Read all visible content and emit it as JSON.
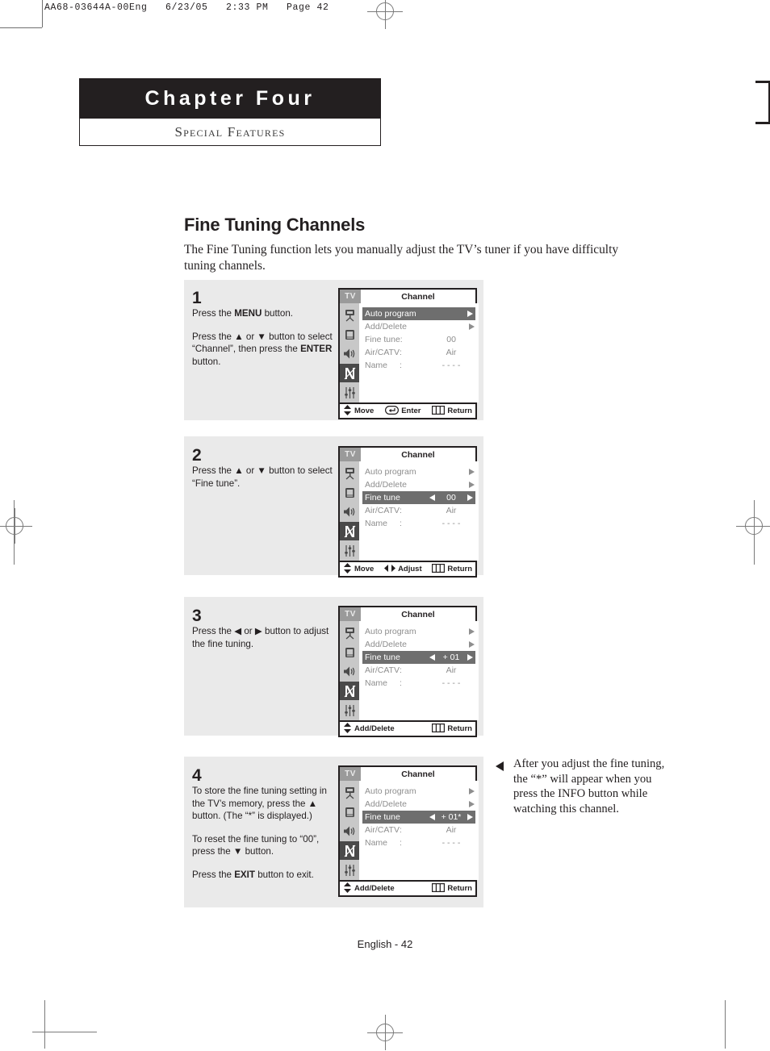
{
  "print_header": "AA68-03644A-00Eng   6/23/05   2:33 PM   Page 42",
  "chapter": {
    "title": "Chapter Four",
    "subtitle": "Special Features"
  },
  "page": {
    "heading": "Fine Tuning Channels",
    "intro": "The Fine Tuning function lets you manually adjust the TV’s tuner if you have difficulty tuning channels.",
    "footer": "English - 42"
  },
  "note": {
    "text": "After you adjust the fine tuning, the “*” will appear when you press the INFO button while watching this channel."
  },
  "osd_common": {
    "tv_label": "TV",
    "title": "Channel",
    "rail_icons": [
      "antenna-icon",
      "picture-icon",
      "sound-icon",
      "channel-icon",
      "setup-icon"
    ],
    "selected_rail_index": 3
  },
  "steps": [
    {
      "number": "1",
      "paragraphs": [
        "Press the MENU button.",
        "Press the ▲ or ▼ button to select “Channel”, then press the ENTER button."
      ],
      "osd": {
        "rows": [
          {
            "label": "Auto program",
            "value": "",
            "colon": false,
            "arrow": "right",
            "highlight": true
          },
          {
            "label": "Add/Delete",
            "value": "",
            "colon": false,
            "arrow": "right",
            "highlight": false
          },
          {
            "label": "Fine tune",
            "value": "00",
            "colon": true,
            "arrow": "none",
            "highlight": false
          },
          {
            "label": "Air/CATV",
            "value": "Air",
            "colon": true,
            "arrow": "none",
            "highlight": false
          },
          {
            "label": "Name",
            "value": "- - - -",
            "colon": true,
            "arrow": "none",
            "highlight": false
          }
        ],
        "bottom": [
          {
            "icon": "updown-arrow-icon",
            "label": "Move"
          },
          {
            "icon": "enter-key-icon",
            "label": "Enter"
          },
          {
            "icon": "menu-bars-icon",
            "label": "Return"
          }
        ]
      }
    },
    {
      "number": "2",
      "paragraphs": [
        "Press the ▲ or ▼ button to select “Fine tune”."
      ],
      "osd": {
        "rows": [
          {
            "label": "Auto program",
            "value": "",
            "colon": false,
            "arrow": "right",
            "highlight": false
          },
          {
            "label": "Add/Delete",
            "value": "",
            "colon": false,
            "arrow": "right",
            "highlight": false
          },
          {
            "label": "Fine tune",
            "value": "00",
            "colon": false,
            "arrow": "both",
            "highlight": true
          },
          {
            "label": "Air/CATV",
            "value": "Air",
            "colon": true,
            "arrow": "none",
            "highlight": false
          },
          {
            "label": "Name",
            "value": "- - - -",
            "colon": true,
            "arrow": "none",
            "highlight": false
          }
        ],
        "bottom": [
          {
            "icon": "updown-arrow-icon",
            "label": "Move"
          },
          {
            "icon": "leftright-arrow-icon",
            "label": "Adjust"
          },
          {
            "icon": "menu-bars-icon",
            "label": "Return"
          }
        ]
      }
    },
    {
      "number": "3",
      "paragraphs": [
        "Press the ◀ or ▶ button to adjust the fine tuning."
      ],
      "osd": {
        "rows": [
          {
            "label": "Auto program",
            "value": "",
            "colon": false,
            "arrow": "right",
            "highlight": false
          },
          {
            "label": "Add/Delete",
            "value": "",
            "colon": false,
            "arrow": "right",
            "highlight": false
          },
          {
            "label": "Fine tune",
            "value": "+ 01",
            "colon": false,
            "arrow": "both",
            "highlight": true
          },
          {
            "label": "Air/CATV",
            "value": "Air",
            "colon": true,
            "arrow": "none",
            "highlight": false
          },
          {
            "label": "Name",
            "value": "- - - -",
            "colon": true,
            "arrow": "none",
            "highlight": false
          }
        ],
        "bottom": [
          {
            "icon": "updown-arrow-icon",
            "label": "Add/Delete"
          },
          {
            "icon": "menu-bars-icon",
            "label": "Return"
          }
        ]
      }
    },
    {
      "number": "4",
      "paragraphs": [
        "To store the fine tuning setting in the TV’s memory, press the ▲ button. (The “*” is displayed.)",
        "To reset the fine tuning to “00”, press the ▼ button.",
        "Press the EXIT button to exit."
      ],
      "osd": {
        "rows": [
          {
            "label": "Auto program",
            "value": "",
            "colon": false,
            "arrow": "right",
            "highlight": false
          },
          {
            "label": "Add/Delete",
            "value": "",
            "colon": false,
            "arrow": "right",
            "highlight": false
          },
          {
            "label": "Fine tune",
            "value": "+ 01*",
            "colon": false,
            "arrow": "both",
            "highlight": true
          },
          {
            "label": "Air/CATV",
            "value": "Air",
            "colon": true,
            "arrow": "none",
            "highlight": false
          },
          {
            "label": "Name",
            "value": "- - - -",
            "colon": true,
            "arrow": "none",
            "highlight": false
          }
        ],
        "bottom": [
          {
            "icon": "updown-arrow-icon",
            "label": "Add/Delete"
          },
          {
            "icon": "menu-bars-icon",
            "label": "Return"
          }
        ]
      }
    }
  ]
}
